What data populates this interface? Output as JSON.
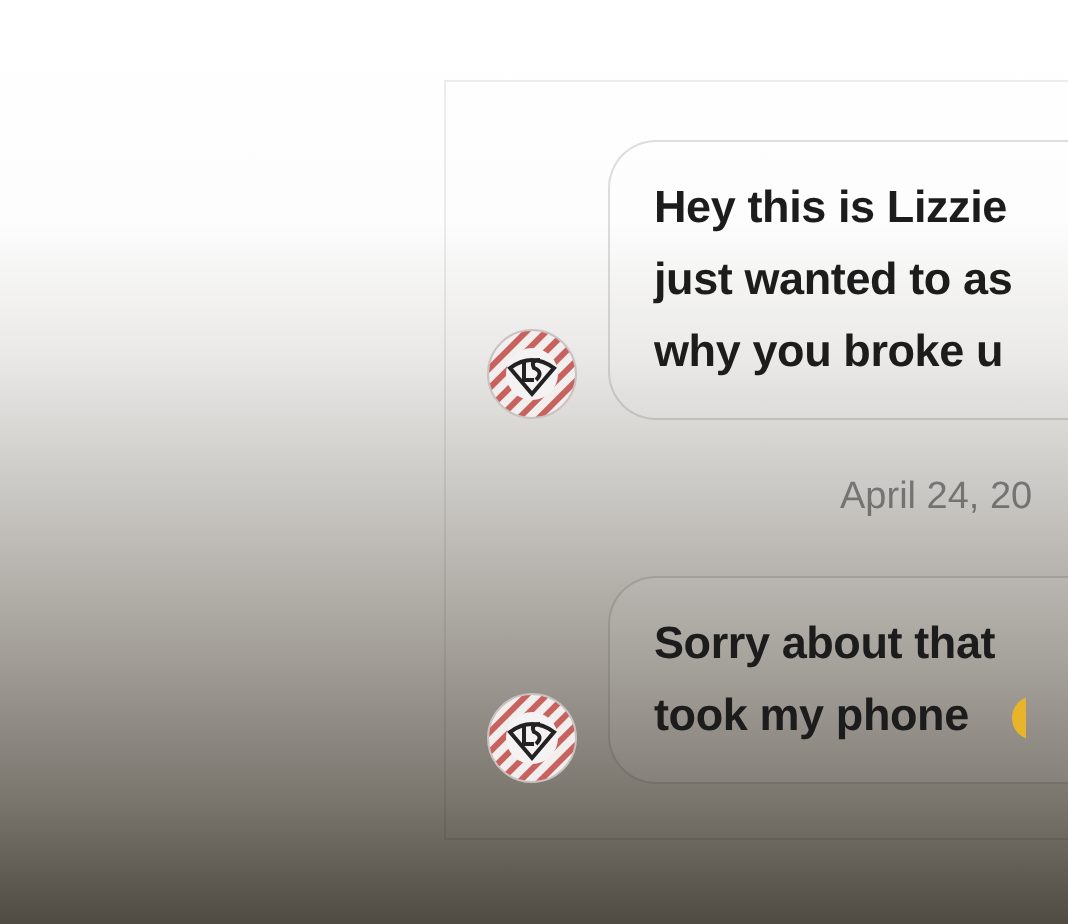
{
  "messages": [
    {
      "kind": "bubble",
      "text": "Hey this is Lizzie\njust wanted to as\nwhy you broke u",
      "trailing_emoji": false
    },
    {
      "kind": "date",
      "text": "April 24, 20"
    },
    {
      "kind": "bubble",
      "text": "Sorry about that\ntook my phone",
      "trailing_emoji": true
    }
  ]
}
